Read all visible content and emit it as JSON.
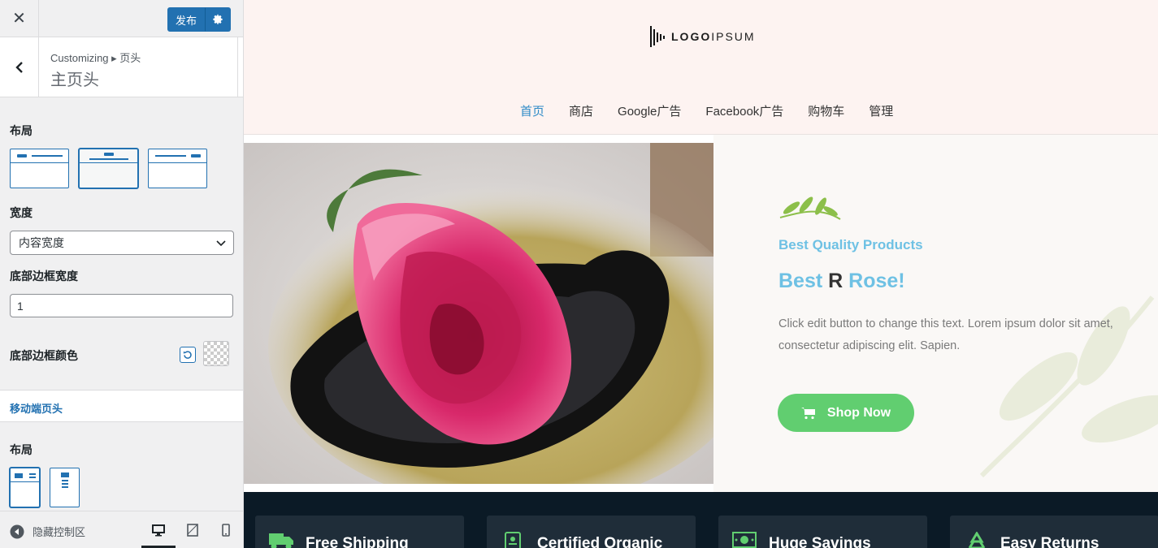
{
  "topbar": {
    "publish_label": "发布"
  },
  "section": {
    "breadcrumb": "Customizing ▸ 页头",
    "title": "主页头"
  },
  "controls": {
    "layout_label": "布局",
    "width_label": "宽度",
    "width_value": "内容宽度",
    "border_width_label": "底部边框宽度",
    "border_width_value": "1",
    "border_color_label": "底部边框颜色",
    "mobile_header_label": "移动端页头",
    "mobile_layout_label": "布局"
  },
  "footer": {
    "hide_controls_label": "隐藏控制区"
  },
  "site": {
    "logo_bold": "LOGO",
    "logo_light": "IPSUM",
    "nav": [
      "首页",
      "商店",
      "Google广告",
      "Facebook广告",
      "购物车",
      "管理"
    ],
    "nav_active": "首页"
  },
  "hero": {
    "eyebrow": "Best Quality Products",
    "headline_a": "Best",
    "headline_b": "R",
    "headline_c": "Rose!",
    "body": "Click edit button to change this text. Lorem ipsum dolor sit amet, consectetur adipiscing elit. Sapien.",
    "button_label": "Shop Now"
  },
  "features": [
    {
      "icon": "truck-icon",
      "label": "Free Shipping"
    },
    {
      "icon": "certificate-icon",
      "label": "Certified Organic"
    },
    {
      "icon": "money-icon",
      "label": "Huge Savings"
    },
    {
      "icon": "recycle-icon",
      "label": "Easy Returns"
    }
  ],
  "colors": {
    "accent": "#2271b1",
    "brand_blue": "#6ec1e4",
    "button_green": "#61ce70",
    "header_bg": "#fdf3f1",
    "footer_dark": "#0b1a26"
  }
}
